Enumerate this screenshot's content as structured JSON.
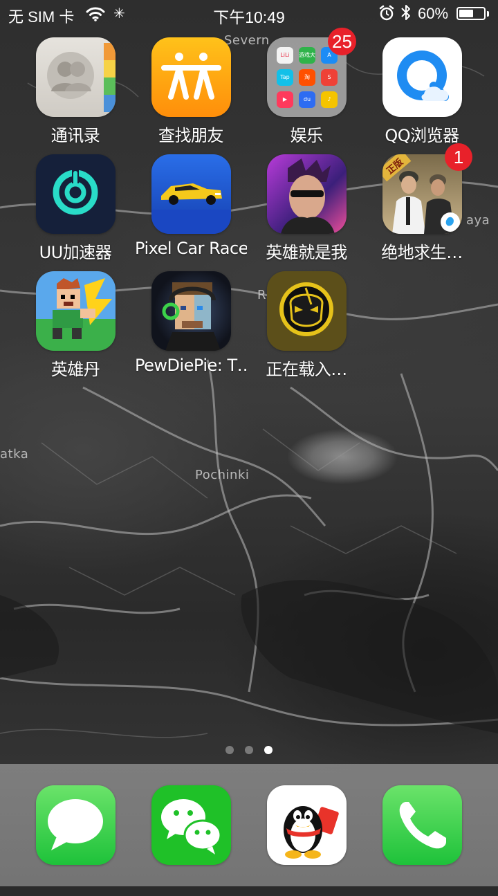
{
  "status_bar": {
    "carrier": "无 SIM 卡",
    "time": "下午10:49",
    "battery_text": "60%",
    "battery_level": 0.6,
    "icons": [
      "wifi-icon",
      "loading-icon",
      "alarm-icon",
      "bluetooth-icon",
      "battery-icon"
    ]
  },
  "map_labels": [
    "Severn",
    "Pochinki",
    "atka",
    "aya",
    "R"
  ],
  "apps": [
    {
      "label": "通讯录",
      "icon": "contacts-icon"
    },
    {
      "label": "查找朋友",
      "icon": "find-friends-icon"
    },
    {
      "label": "娱乐",
      "icon": "folder-icon",
      "badge": "25",
      "folder_items": [
        {
          "text": "LiLi",
          "color": "#f3f3f3"
        },
        {
          "text": "游戏大全",
          "color": "#2fb34a"
        },
        {
          "text": "A",
          "color": "#1c8cf5"
        },
        {
          "text": "Tap",
          "color": "#12c0e8"
        },
        {
          "text": "淘",
          "color": "#ff5000"
        },
        {
          "text": "S",
          "color": "#ef4136"
        },
        {
          "text": "▶",
          "color": "#ff3a5c"
        },
        {
          "text": "du",
          "color": "#2d6cf2"
        },
        {
          "text": "♪",
          "color": "#f5c400"
        }
      ]
    },
    {
      "label": "QQ浏览器",
      "icon": "qq-browser-icon"
    },
    {
      "label": "UU加速器",
      "icon": "uu-accelerator-icon"
    },
    {
      "label": "Pixel Car Racer",
      "icon": "pixel-car-racer-icon"
    },
    {
      "label": "英雄就是我",
      "icon": "hero-is-me-icon"
    },
    {
      "label": "绝地求生…",
      "icon": "pubg-mobile-icon",
      "badge": "1",
      "icon_text": "正版"
    },
    {
      "label": "英雄丹",
      "icon": "dan-the-man-icon"
    },
    {
      "label": "PewDiePie: T…",
      "icon": "pewdiepie-icon"
    },
    {
      "label": "正在载入…",
      "icon": "loading-app-icon"
    }
  ],
  "dock": [
    {
      "name": "Messages",
      "icon": "messages-icon"
    },
    {
      "name": "WeChat",
      "icon": "wechat-icon"
    },
    {
      "name": "QQ",
      "icon": "qq-icon"
    },
    {
      "name": "Phone",
      "icon": "phone-icon"
    }
  ],
  "page_dots": {
    "count": 3,
    "active": 3
  }
}
